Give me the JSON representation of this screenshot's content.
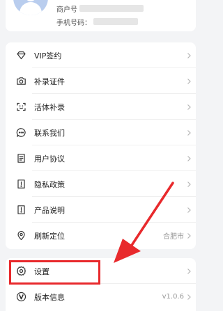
{
  "profile": {
    "merchant_label": "商户号",
    "phone_label": "手机号码："
  },
  "menu": {
    "items": [
      {
        "label": "VIP签约",
        "icon": "diamond-icon"
      },
      {
        "label": "补录证件",
        "icon": "camera-icon"
      },
      {
        "label": "活体补录",
        "icon": "face-scan-icon"
      },
      {
        "label": "联系我们",
        "icon": "chat-bubble-icon"
      },
      {
        "label": "用户协议",
        "icon": "document-icon"
      },
      {
        "label": "隐私政策",
        "icon": "privacy-doc-icon"
      },
      {
        "label": "产品说明",
        "icon": "info-doc-icon"
      },
      {
        "label": "刷新定位",
        "icon": "location-pin-icon",
        "value": "合肥市"
      }
    ]
  },
  "bottom": {
    "items": [
      {
        "label": "设置",
        "icon": "gear-icon"
      },
      {
        "label": "版本信息",
        "icon": "version-icon",
        "value": "v1.0.6"
      }
    ]
  },
  "annotation": {
    "highlight_color": "#e8292c",
    "arrow_color": "#e8292c"
  }
}
